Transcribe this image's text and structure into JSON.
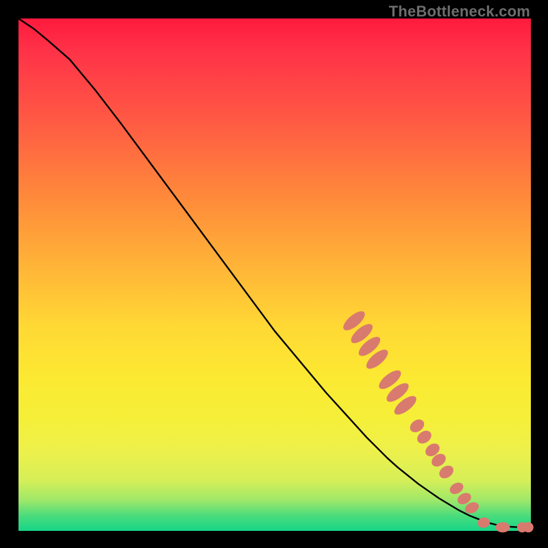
{
  "watermark": "TheBottleneck.com",
  "colors": {
    "curve": "#000000",
    "marker_fill": "#d97a6f",
    "marker_stroke": "#d97a6f"
  },
  "chart_data": {
    "type": "line",
    "title": "",
    "xlabel": "",
    "ylabel": "",
    "xlim": [
      0,
      100
    ],
    "ylim": [
      0,
      100
    ],
    "grid": false,
    "curve": {
      "x": [
        0,
        3,
        6,
        10,
        15,
        20,
        30,
        40,
        50,
        60,
        65,
        68,
        70,
        72,
        74,
        76,
        78,
        80,
        82,
        84,
        86,
        88,
        90,
        92,
        94,
        96,
        98,
        100
      ],
      "y": [
        100,
        98,
        95.5,
        92,
        86,
        79.5,
        66,
        52.5,
        39,
        27,
        21.5,
        18.2,
        16.2,
        14.2,
        12.4,
        10.8,
        9.2,
        7.8,
        6.4,
        5.2,
        4.0,
        3.0,
        2.2,
        1.5,
        1.0,
        0.8,
        0.7,
        0.7
      ]
    },
    "markers": [
      {
        "x": 65.5,
        "y": 41.0,
        "rx": 1.1,
        "ry": 2.6,
        "rot": 50
      },
      {
        "x": 67.0,
        "y": 38.5,
        "rx": 1.1,
        "ry": 2.6,
        "rot": 50
      },
      {
        "x": 68.5,
        "y": 36.0,
        "rx": 1.1,
        "ry": 2.6,
        "rot": 50
      },
      {
        "x": 70.0,
        "y": 33.5,
        "rx": 1.1,
        "ry": 2.6,
        "rot": 50
      },
      {
        "x": 72.5,
        "y": 29.5,
        "rx": 1.1,
        "ry": 2.6,
        "rot": 52
      },
      {
        "x": 74.0,
        "y": 27.0,
        "rx": 1.1,
        "ry": 2.6,
        "rot": 52
      },
      {
        "x": 75.5,
        "y": 24.5,
        "rx": 1.1,
        "ry": 2.6,
        "rot": 52
      },
      {
        "x": 77.8,
        "y": 20.5,
        "rx": 1.1,
        "ry": 1.5,
        "rot": 55
      },
      {
        "x": 79.2,
        "y": 18.3,
        "rx": 1.1,
        "ry": 1.5,
        "rot": 55
      },
      {
        "x": 80.8,
        "y": 15.8,
        "rx": 1.1,
        "ry": 1.5,
        "rot": 55
      },
      {
        "x": 82.0,
        "y": 13.8,
        "rx": 1.1,
        "ry": 1.5,
        "rot": 55
      },
      {
        "x": 83.5,
        "y": 11.5,
        "rx": 1.1,
        "ry": 1.5,
        "rot": 55
      },
      {
        "x": 85.5,
        "y": 8.3,
        "rx": 1.0,
        "ry": 1.4,
        "rot": 60
      },
      {
        "x": 87.0,
        "y": 6.3,
        "rx": 1.0,
        "ry": 1.4,
        "rot": 62
      },
      {
        "x": 88.5,
        "y": 4.5,
        "rx": 1.0,
        "ry": 1.4,
        "rot": 65
      },
      {
        "x": 90.8,
        "y": 1.6,
        "rx": 1.0,
        "ry": 1.2,
        "rot": 78
      },
      {
        "x": 94.5,
        "y": 0.7,
        "rx": 1.4,
        "ry": 1.0,
        "rot": 0
      },
      {
        "x": 98.3,
        "y": 0.7,
        "rx": 1.0,
        "ry": 1.0,
        "rot": 0
      },
      {
        "x": 99.5,
        "y": 0.7,
        "rx": 1.0,
        "ry": 1.0,
        "rot": 0
      }
    ]
  }
}
